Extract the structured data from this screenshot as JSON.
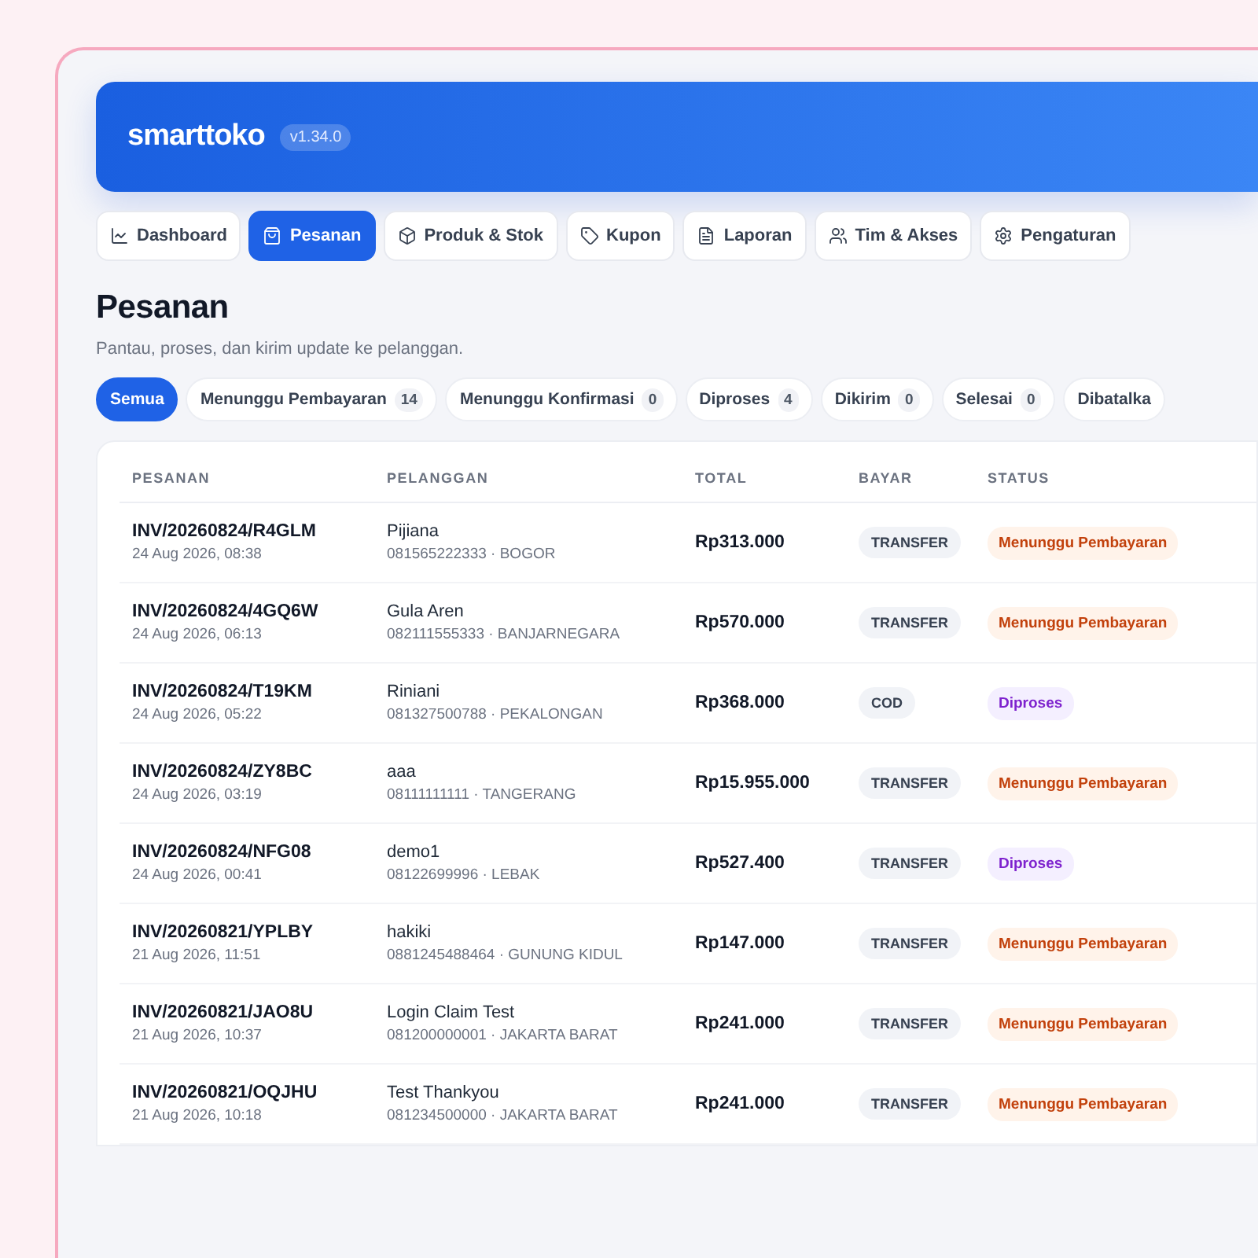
{
  "brand": {
    "logo": "smarttoko",
    "version": "v1.34.0"
  },
  "nav": [
    {
      "label": "Dashboard",
      "selected": false
    },
    {
      "label": "Pesanan",
      "selected": true
    },
    {
      "label": "Produk & Stok",
      "selected": false
    },
    {
      "label": "Kupon",
      "selected": false
    },
    {
      "label": "Laporan",
      "selected": false
    },
    {
      "label": "Tim & Akses",
      "selected": false
    },
    {
      "label": "Pengaturan",
      "selected": false
    }
  ],
  "page": {
    "title": "Pesanan",
    "subtitle": "Pantau, proses, dan kirim update ke pelanggan."
  },
  "filters": [
    {
      "label": "Semua",
      "selected": true
    },
    {
      "label": "Menunggu Pembayaran",
      "count": "14",
      "selected": false
    },
    {
      "label": "Menunggu Konfirmasi",
      "count": "0",
      "selected": false
    },
    {
      "label": "Diproses",
      "count": "4",
      "selected": false
    },
    {
      "label": "Dikirim",
      "count": "0",
      "selected": false
    },
    {
      "label": "Selesai",
      "count": "0",
      "selected": false
    },
    {
      "label": "Dibatalka",
      "selected": false
    }
  ],
  "table": {
    "columns": [
      "PESANAN",
      "PELANGGAN",
      "TOTAL",
      "BAYAR",
      "STATUS"
    ],
    "rows": [
      {
        "invoice": "INV/20260824/R4GLM",
        "date": "24 Aug 2026, 08:38",
        "customer": "Pijiana",
        "contact": "081565222333 · BOGOR",
        "total": "Rp313.000",
        "payment": "TRANSFER",
        "status": {
          "label": "Menunggu Pembayaran",
          "kind": "waiting"
        }
      },
      {
        "invoice": "INV/20260824/4GQ6W",
        "date": "24 Aug 2026, 06:13",
        "customer": "Gula Aren",
        "contact": "082111555333 · BANJARNEGARA",
        "total": "Rp570.000",
        "payment": "TRANSFER",
        "status": {
          "label": "Menunggu Pembayaran",
          "kind": "waiting"
        }
      },
      {
        "invoice": "INV/20260824/T19KM",
        "date": "24 Aug 2026, 05:22",
        "customer": "Riniani",
        "contact": "081327500788 · PEKALONGAN",
        "total": "Rp368.000",
        "payment": "COD",
        "status": {
          "label": "Diproses",
          "kind": "processing"
        }
      },
      {
        "invoice": "INV/20260824/ZY8BC",
        "date": "24 Aug 2026, 03:19",
        "customer": "aaa",
        "contact": "08111111111 · TANGERANG",
        "total": "Rp15.955.000",
        "payment": "TRANSFER",
        "status": {
          "label": "Menunggu Pembayaran",
          "kind": "waiting"
        }
      },
      {
        "invoice": "INV/20260824/NFG08",
        "date": "24 Aug 2026, 00:41",
        "customer": "demo1",
        "contact": "08122699996 · LEBAK",
        "total": "Rp527.400",
        "payment": "TRANSFER",
        "status": {
          "label": "Diproses",
          "kind": "processing"
        }
      },
      {
        "invoice": "INV/20260821/YPLBY",
        "date": "21 Aug 2026, 11:51",
        "customer": "hakiki",
        "contact": "0881245488464 · GUNUNG KIDUL",
        "total": "Rp147.000",
        "payment": "TRANSFER",
        "status": {
          "label": "Menunggu Pembayaran",
          "kind": "waiting"
        }
      },
      {
        "invoice": "INV/20260821/JAO8U",
        "date": "21 Aug 2026, 10:37",
        "customer": "Login Claim Test",
        "contact": "081200000001 · JAKARTA BARAT",
        "total": "Rp241.000",
        "payment": "TRANSFER",
        "status": {
          "label": "Menunggu Pembayaran",
          "kind": "waiting"
        }
      },
      {
        "invoice": "INV/20260821/OQJHU",
        "date": "21 Aug 2026, 10:18",
        "customer": "Test Thankyou",
        "contact": "081234500000 · JAKARTA BARAT",
        "total": "Rp241.000",
        "payment": "TRANSFER",
        "status": {
          "label": "Menunggu Pembayaran",
          "kind": "waiting"
        }
      }
    ]
  }
}
